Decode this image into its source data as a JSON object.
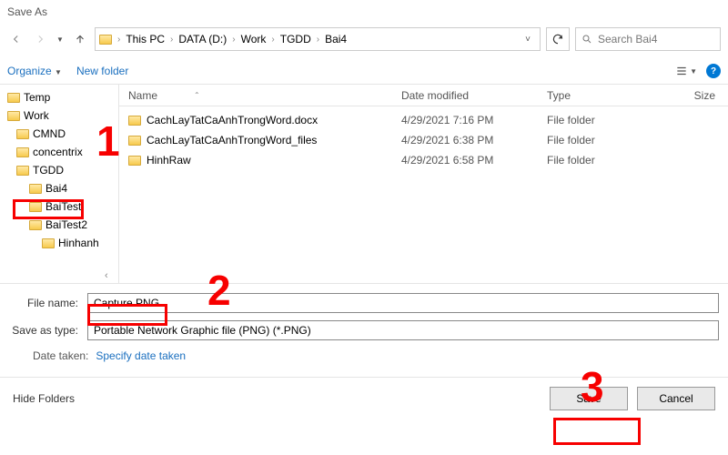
{
  "title": "Save As",
  "breadcrumb": [
    "This PC",
    "DATA (D:)",
    "Work",
    "TGDD",
    "Bai4"
  ],
  "search": {
    "placeholder": "Search Bai4"
  },
  "toolbar": {
    "organize": "Organize",
    "newfolder": "New folder"
  },
  "tree": [
    {
      "label": "Temp",
      "level": 0
    },
    {
      "label": "Work",
      "level": 0
    },
    {
      "label": "CMND",
      "level": 1
    },
    {
      "label": "concentrix",
      "level": 1
    },
    {
      "label": "TGDD",
      "level": 1
    },
    {
      "label": "Bai4",
      "level": 2
    },
    {
      "label": "BaiTest",
      "level": 2
    },
    {
      "label": "BaiTest2",
      "level": 2
    },
    {
      "label": "Hinhanh",
      "level": 3
    }
  ],
  "columns": {
    "name": "Name",
    "date": "Date modified",
    "type": "Type",
    "size": "Size"
  },
  "files": [
    {
      "name": "CachLayTatCaAnhTrongWord.docx",
      "date": "4/29/2021 7:16 PM",
      "type": "File folder"
    },
    {
      "name": "CachLayTatCaAnhTrongWord_files",
      "date": "4/29/2021 6:38 PM",
      "type": "File folder"
    },
    {
      "name": "HinhRaw",
      "date": "4/29/2021 6:58 PM",
      "type": "File folder"
    }
  ],
  "form": {
    "filename_label": "File name:",
    "filename_value": "Capture.PNG",
    "type_label": "Save as type:",
    "type_value": "Portable Network Graphic file (PNG) (*.PNG)",
    "date_label": "Date taken:",
    "date_value": "Specify date taken"
  },
  "footer": {
    "hide": "Hide Folders",
    "save": "Save",
    "cancel": "Cancel"
  },
  "annotations": {
    "n1": "1",
    "n2": "2",
    "n3": "3"
  }
}
